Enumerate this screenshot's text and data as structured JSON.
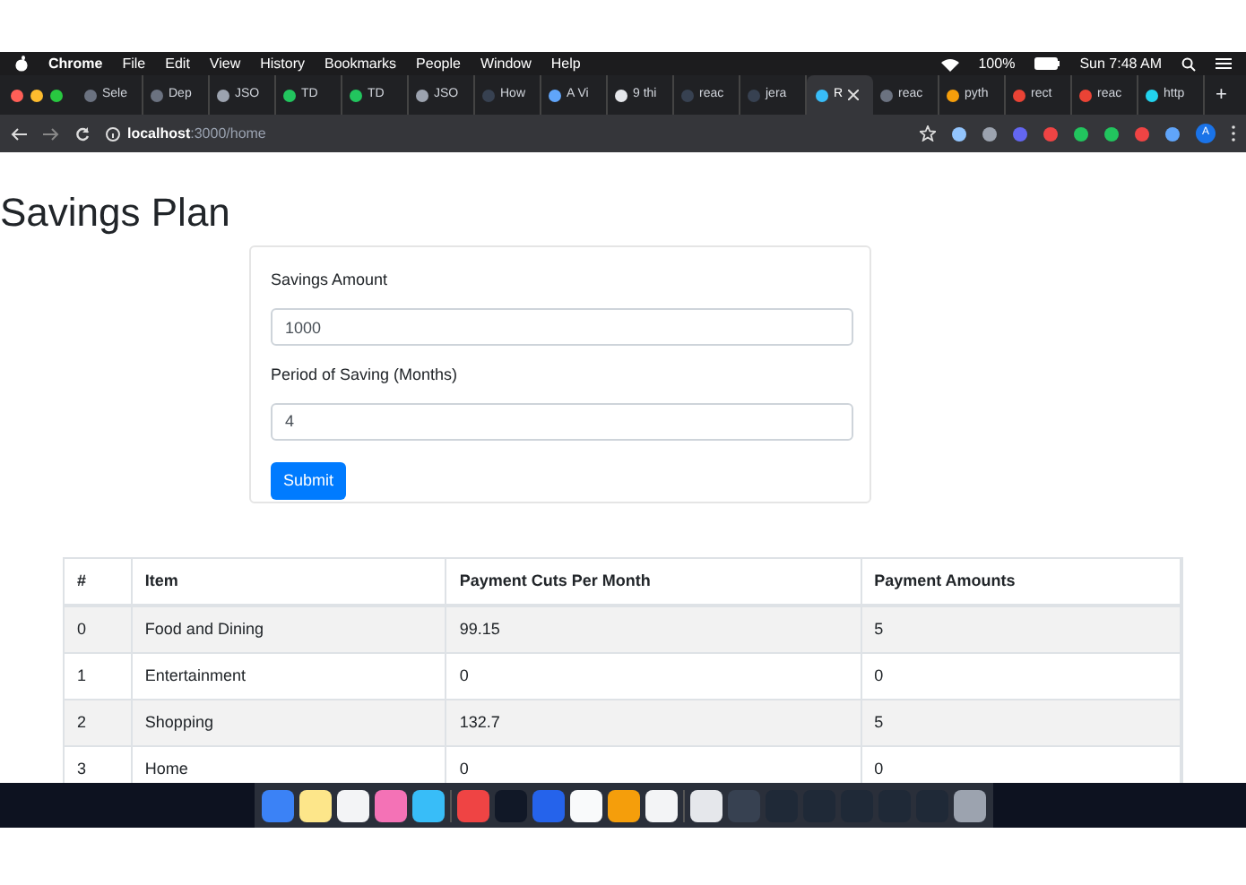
{
  "menu_bar": {
    "items": [
      "Chrome",
      "File",
      "Edit",
      "View",
      "History",
      "Bookmarks",
      "People",
      "Window",
      "Help"
    ],
    "battery": "100%",
    "clock": "Sun 7:48 AM"
  },
  "tabs": [
    {
      "label": "Sele",
      "selected": false,
      "color": "#6b7280"
    },
    {
      "label": "Dep",
      "selected": false,
      "color": "#6b7280"
    },
    {
      "label": "JSO",
      "selected": false,
      "color": "#9ca3af"
    },
    {
      "label": "TD",
      "selected": false,
      "color": "#22c55e"
    },
    {
      "label": "TD",
      "selected": false,
      "color": "#22c55e"
    },
    {
      "label": "JSO",
      "selected": false,
      "color": "#9ca3af"
    },
    {
      "label": "How",
      "selected": false,
      "color": "#374151"
    },
    {
      "label": "A Vi",
      "selected": false,
      "color": "#60a5fa"
    },
    {
      "label": "9 thi",
      "selected": false,
      "color": "#e5e7eb"
    },
    {
      "label": "reac",
      "selected": false,
      "color": "#374151"
    },
    {
      "label": "jera",
      "selected": false,
      "color": "#374151"
    },
    {
      "label": "R",
      "selected": true,
      "color": "#38bdf8"
    },
    {
      "label": "reac",
      "selected": false,
      "color": "#6b7280"
    },
    {
      "label": "pyth",
      "selected": false,
      "color": "#f59e0b"
    },
    {
      "label": "rect",
      "selected": false,
      "color": "#ea4335"
    },
    {
      "label": "reac",
      "selected": false,
      "color": "#ea4335"
    },
    {
      "label": "http",
      "selected": false,
      "color": "#22d3ee"
    }
  ],
  "new_tab": "+",
  "address_bar": {
    "host": "localhost",
    "path": ":3000/home"
  },
  "profile": "A",
  "page": {
    "title": "Savings Plan",
    "form": {
      "fields": [
        {
          "label": "Savings Amount",
          "value": "1000"
        },
        {
          "label": "Period of Saving (Months)",
          "value": "4"
        }
      ],
      "submit": "Submit"
    },
    "table": {
      "columns": [
        "#",
        "Item",
        "Payment Cuts Per Month",
        "Payment Amounts"
      ],
      "rows": [
        [
          "0",
          "Food and Dining",
          "99.15",
          "5"
        ],
        [
          "1",
          "Entertainment",
          "0",
          "0"
        ],
        [
          "2",
          "Shopping",
          "132.7",
          "5"
        ],
        [
          "3",
          "Home",
          "0",
          "0"
        ]
      ]
    }
  }
}
